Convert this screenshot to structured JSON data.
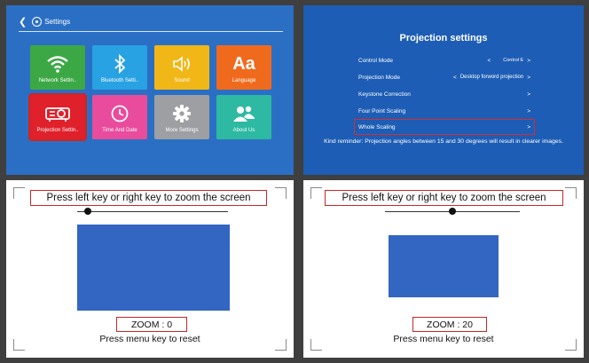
{
  "settings_screen": {
    "title": "Settings",
    "tiles": [
      {
        "label": "Network Settin..",
        "icon": "wifi-icon",
        "color": "#3ca845"
      },
      {
        "label": "Bluetooth Setti..",
        "icon": "bluetooth-icon",
        "color": "#28a2e3"
      },
      {
        "label": "Sound",
        "icon": "speaker-icon",
        "color": "#f1b717"
      },
      {
        "label": "Language",
        "icon": "language-icon",
        "color": "#f06a1d",
        "glyph": "Aa"
      },
      {
        "label": "Projection Settin..",
        "icon": "projector-icon",
        "color": "#e0202a",
        "selected": true
      },
      {
        "label": "Time And Date",
        "icon": "clock-icon",
        "color": "#e94c9c"
      },
      {
        "label": "More Settings",
        "icon": "gear-icon",
        "color": "#9d9fa2"
      },
      {
        "label": "About Us",
        "icon": "people-icon",
        "color": "#2db9a2"
      }
    ]
  },
  "projection_screen": {
    "title": "Projection settings",
    "rows": [
      {
        "label": "Control Mode",
        "value": "Control E",
        "left_arrow": "<",
        "right_arrow": ">"
      },
      {
        "label": "Projection Mode",
        "value": "Desktop forword projection",
        "left_arrow": "<",
        "right_arrow": ">"
      },
      {
        "label": "Keystone Correction",
        "value": "",
        "left_arrow": "",
        "right_arrow": ">"
      },
      {
        "label": "Four Point Scaling",
        "value": "",
        "left_arrow": "",
        "right_arrow": ">"
      },
      {
        "label": "Whole Scaling",
        "value": "",
        "left_arrow": "",
        "right_arrow": ">",
        "selected": true
      }
    ],
    "reminder": "Kind reminder: Projection angles between 15 and 30 degrees will result in clearer images."
  },
  "zoom_screens": [
    {
      "prompt": "Press left key or right key to zoom the screen",
      "zoom_label": "ZOOM : 0",
      "zoom_value": 0,
      "reset": "Press menu key to reset",
      "slider_fraction": 0.0
    },
    {
      "prompt": "Press left key or right key to zoom the screen",
      "zoom_label": "ZOOM : 20",
      "zoom_value": 20,
      "reset": "Press menu key to reset",
      "slider_fraction": 0.5
    }
  ],
  "colors": {
    "highlight": "#c62828",
    "screen_blue": "#3266c2"
  }
}
